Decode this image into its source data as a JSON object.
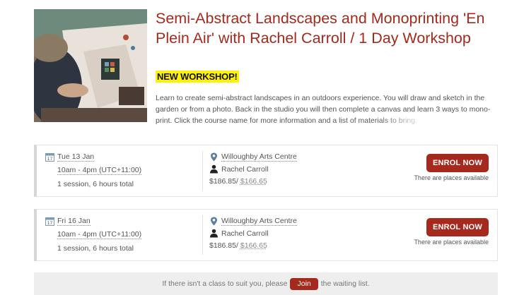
{
  "course": {
    "title": "Semi-Abstract Landscapes and Monoprinting 'En Plein Air' with Rachel Carroll / 1 Day Workshop",
    "badge": "NEW WORKSHOP!",
    "description": "Learn to create semi-abstract landscapes in an outdoors experience. You will draw and sketch in the garden or from a photo. Back in the studio you will then complete a canvas and learn 3 ways to mono-print. Click the course name for more information and ",
    "description_faded": "a list of materials to bring."
  },
  "sessions": [
    {
      "date": "Tue 13 Jan",
      "time": "10am - 4pm (UTC+11:00)",
      "summary": "1 session, 6 hours total",
      "venue": "Willoughby Arts Centre",
      "tutor": "Rachel Carroll",
      "price": "$186.85",
      "price_sep": "/",
      "price_old": "$166.65",
      "enrol_label": "ENROL NOW",
      "availability": "There are places available"
    },
    {
      "date": "Fri 16 Jan",
      "time": "10am - 4pm (UTC+11:00)",
      "summary": "1 session, 6 hours total",
      "venue": "Willoughby Arts Centre",
      "tutor": "Rachel Carroll",
      "price": "$186.85",
      "price_sep": "/",
      "price_old": "$166.65",
      "enrol_label": "ENROL NOW",
      "availability": "There are places available"
    }
  ],
  "waitlist": {
    "prefix": "If there isn't a class to suit you, please",
    "join_label": "Join",
    "suffix": "the waiting list."
  },
  "colors": {
    "accent": "#a5291c",
    "badge": "#fff200"
  },
  "icons": {
    "calendar": "calendar-icon",
    "venue": "map-pin-icon",
    "tutor": "person-icon"
  }
}
